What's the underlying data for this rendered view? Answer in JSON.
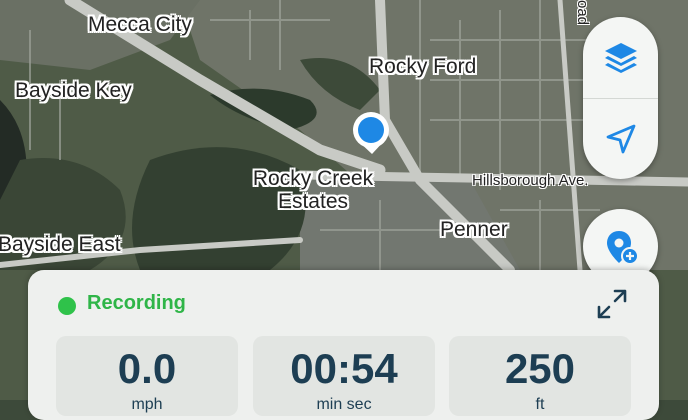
{
  "map": {
    "labels": [
      {
        "text": "Mecca City"
      },
      {
        "text": "Bayside Key"
      },
      {
        "text": "Rocky Ford"
      },
      {
        "text": "Rocky Creek\nEstates"
      },
      {
        "text": "Bayside East"
      },
      {
        "text": "Penner"
      }
    ],
    "roads": [
      {
        "text": "Hillsborough Ave."
      },
      {
        "text": "oad"
      }
    ],
    "location_marker_color": "#1e88e5"
  },
  "controls": {
    "layers_icon": "layers-icon",
    "locate_icon": "navigation-arrow-icon",
    "add_pin_icon": "add-location-pin-icon",
    "icon_color": "#1e88e5"
  },
  "recording": {
    "status": "Recording",
    "status_color": "#2fc24a",
    "expand_icon": "expand-icon",
    "stats": [
      {
        "value": "0.0",
        "unit": "mph"
      },
      {
        "value": "00:54",
        "unit": "min sec"
      },
      {
        "value": "250",
        "unit": "ft"
      }
    ]
  }
}
